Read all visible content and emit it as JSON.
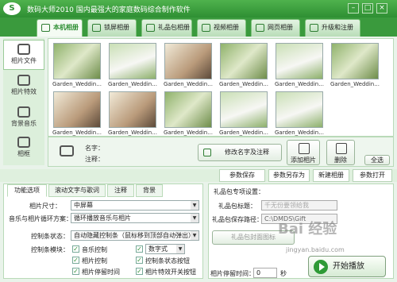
{
  "window": {
    "title": "数码大师2010    国内最强大的家庭数码综合制作软件"
  },
  "tabs": [
    {
      "label": "本机相册",
      "active": true
    },
    {
      "label": "锁屏相册"
    },
    {
      "label": "礼品包相册"
    },
    {
      "label": "视频相册"
    },
    {
      "label": "网页相册"
    },
    {
      "label": "升级和注册"
    }
  ],
  "sidebar": [
    {
      "label": "相片文件"
    },
    {
      "label": "相片特效"
    },
    {
      "label": "背景音乐"
    },
    {
      "label": "相框"
    }
  ],
  "thumbnails": [
    {
      "label": "Garden_Weddin..."
    },
    {
      "label": "Garden_Weddin..."
    },
    {
      "label": "Garden_Weddin..."
    },
    {
      "label": "Garden_Weddin..."
    },
    {
      "label": "Garden_Weddin..."
    },
    {
      "label": "Garden_Weddin..."
    },
    {
      "label": "Garden_Weddin..."
    },
    {
      "label": "Garden_Weddin..."
    },
    {
      "label": "Garden_Weddin..."
    },
    {
      "label": "Garden_Weddin..."
    },
    {
      "label": "Garden_Weddin..."
    }
  ],
  "info": {
    "name_label": "名字：",
    "note_label": "注释：",
    "rename_button": "修改名字及注释",
    "add_button": "添加相片",
    "delete_button": "删除",
    "select_all_button": "全选"
  },
  "toolrow": {
    "param_save": "参数保存",
    "param_save_as": "参数另存为",
    "new_album": "新建相册",
    "param_open": "参数打开"
  },
  "options_tabs": [
    "功能选项",
    "滚动文字与歌词",
    "注释",
    "背景"
  ],
  "options": {
    "size_label": "相片尺寸：",
    "size_value": "中屏幕",
    "loop_label": "音乐与相片循环方案：",
    "loop_value": "循环播放音乐与相片",
    "control_label": "控制条状态：",
    "control_value": "自动隐藏控制条（鼠标移到顶部自动弹出）",
    "module_label": "控制条模块：",
    "checks": [
      {
        "label": "音乐控制",
        "checked": true
      },
      {
        "label": "数字式",
        "checked": true
      },
      {
        "label": "相片控制",
        "checked": true
      },
      {
        "label": "控制条状态按钮",
        "checked": true
      },
      {
        "label": "相片停留时间",
        "checked": true
      },
      {
        "label": "相片特效开关按钮",
        "checked": true
      }
    ]
  },
  "gift": {
    "header": "礼品包专项设置：",
    "title_label": "礼品包标题：",
    "title_placeholder": "千无份要领给我",
    "path_label": "礼品包保存路径：",
    "path_value": "C:\\DMDS\\Gift",
    "icon_button": "礼品包封面图标",
    "stay_label": "相片停留时间：",
    "stay_value": "0",
    "stay_unit": "秒",
    "play_button": "开始播放"
  },
  "watermark": {
    "text": "Bai 经验",
    "url": "jingyan.baidu.com"
  },
  "colors": {
    "brand": "#2e8f33",
    "accent": "#3a9a3d"
  }
}
